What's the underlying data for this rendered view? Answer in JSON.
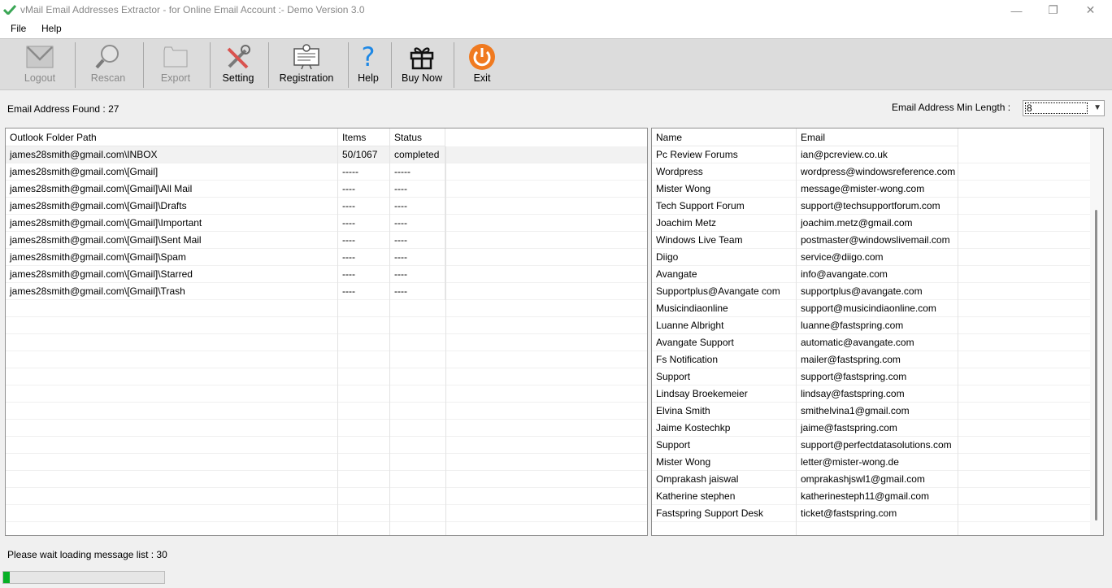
{
  "window": {
    "title": "vMail Email Addresses Extractor - for Online Email Account :- Demo Version 3.0",
    "minimize_glyph": "—",
    "maximize_glyph": "❐",
    "close_glyph": "✕"
  },
  "menu": {
    "file": "File",
    "help": "Help"
  },
  "toolbar": {
    "logout": "Logout",
    "rescan": "Rescan",
    "export": "Export",
    "setting": "Setting",
    "registration": "Registration",
    "help": "Help",
    "buy_now": "Buy Now",
    "exit": "Exit",
    "icons": [
      "envelope-icon",
      "magnifier-icon",
      "folder-icon",
      "tools-icon",
      "certificate-icon",
      "question-icon",
      "gift-icon",
      "power-icon"
    ]
  },
  "summary": {
    "found_label": "Email Address Found : ",
    "found_count": "27",
    "min_length_label": "Email Address Min Length :",
    "min_length_value": "8"
  },
  "folders": {
    "headers": {
      "path": "Outlook Folder Path",
      "items": "Items",
      "status": "Status"
    },
    "rows": [
      {
        "path": "james28smith@gmail.com\\INBOX",
        "items": "50/1067",
        "status": "completed"
      },
      {
        "path": "james28smith@gmail.com\\[Gmail]",
        "items": "-----",
        "status": "-----"
      },
      {
        "path": "james28smith@gmail.com\\[Gmail]\\All Mail",
        "items": "----",
        "status": "----"
      },
      {
        "path": "james28smith@gmail.com\\[Gmail]\\Drafts",
        "items": "----",
        "status": "----"
      },
      {
        "path": "james28smith@gmail.com\\[Gmail]\\Important",
        "items": "----",
        "status": "----"
      },
      {
        "path": "james28smith@gmail.com\\[Gmail]\\Sent Mail",
        "items": "----",
        "status": "----"
      },
      {
        "path": "james28smith@gmail.com\\[Gmail]\\Spam",
        "items": "----",
        "status": "----"
      },
      {
        "path": "james28smith@gmail.com\\[Gmail]\\Starred",
        "items": "----",
        "status": "----"
      },
      {
        "path": "james28smith@gmail.com\\[Gmail]\\Trash",
        "items": "----",
        "status": "----"
      }
    ]
  },
  "emails": {
    "headers": {
      "name": "Name",
      "email": "Email"
    },
    "rows": [
      {
        "name": "Pc Review Forums",
        "email": "ian@pcreview.co.uk"
      },
      {
        "name": "Wordpress",
        "email": "wordpress@windowsreference.com"
      },
      {
        "name": "Mister Wong",
        "email": "message@mister-wong.com"
      },
      {
        "name": "Tech Support Forum",
        "email": "support@techsupportforum.com"
      },
      {
        "name": "Joachim Metz",
        "email": "joachim.metz@gmail.com"
      },
      {
        "name": "Windows Live Team",
        "email": "postmaster@windowslivemail.com"
      },
      {
        "name": "Diigo",
        "email": "service@diigo.com"
      },
      {
        "name": "Avangate",
        "email": "info@avangate.com"
      },
      {
        "name": "Supportplus@Avangate com",
        "email": "supportplus@avangate.com"
      },
      {
        "name": "Musicindiaonline",
        "email": "support@musicindiaonline.com"
      },
      {
        "name": "Luanne Albright",
        "email": "luanne@fastspring.com"
      },
      {
        "name": "Avangate Support",
        "email": "automatic@avangate.com"
      },
      {
        "name": "Fs Notification",
        "email": "mailer@fastspring.com"
      },
      {
        "name": "Support",
        "email": "support@fastspring.com"
      },
      {
        "name": "Lindsay Broekemeier",
        "email": "lindsay@fastspring.com"
      },
      {
        "name": "Elvina Smith",
        "email": "smithelvina1@gmail.com"
      },
      {
        "name": "Jaime Kostechkp",
        "email": "jaime@fastspring.com"
      },
      {
        "name": "Support",
        "email": "support@perfectdatasolutions.com"
      },
      {
        "name": "Mister Wong",
        "email": "letter@mister-wong.de"
      },
      {
        "name": "Omprakash jaiswal",
        "email": "omprakashjswl1@gmail.com"
      },
      {
        "name": "Katherine stephen",
        "email": "katherinesteph11@gmail.com"
      },
      {
        "name": "Fastspring Support Desk",
        "email": "ticket@fastspring.com"
      }
    ]
  },
  "status_text": "Please wait loading message list : 30",
  "progress_fraction": 0.04,
  "colors": {
    "progress": "#06b025",
    "exit_icon": "#f07a20",
    "help_icon": "#1e88e5",
    "app_icon": "#3aa655"
  }
}
